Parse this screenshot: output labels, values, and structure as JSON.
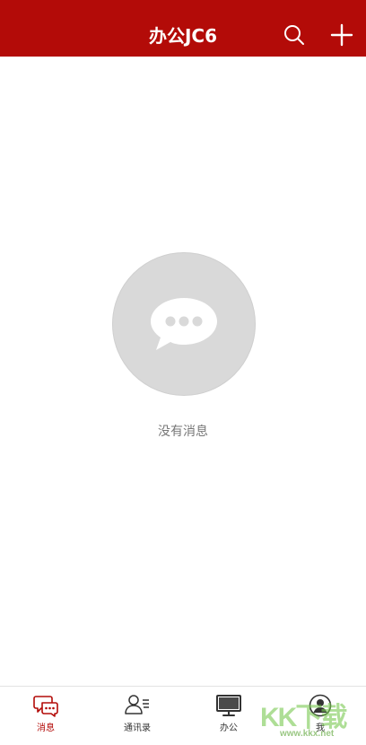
{
  "header": {
    "title": "办公JC6",
    "background": "#b30b08",
    "icons": [
      "search-icon",
      "plus-icon"
    ]
  },
  "empty_state": {
    "icon": "chat-bubble-icon",
    "text": "没有消息"
  },
  "tabbar": {
    "active": "消息",
    "active_color": "#b30b08",
    "items": [
      {
        "label": "消息",
        "icon": "chat-bubbles-icon"
      },
      {
        "label": "通讯录",
        "icon": "contacts-icon"
      },
      {
        "label": "办公",
        "icon": "monitor-icon"
      },
      {
        "label": "我",
        "icon": "user-icon"
      }
    ]
  },
  "watermark": {
    "logo": "KK下载",
    "url": "www.kkx.net"
  }
}
